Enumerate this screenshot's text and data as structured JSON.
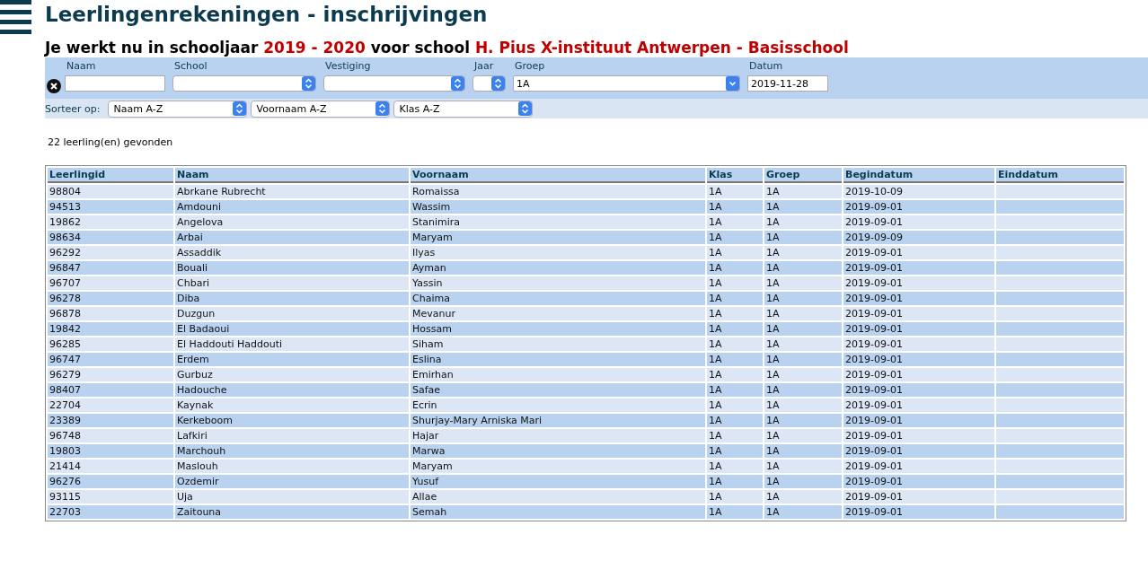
{
  "title": "Leerlingenrekeningen - inschrijvingen",
  "subtitle": [
    {
      "text": "Je werkt nu in schooljaar ",
      "kind": "plain"
    },
    {
      "text": "2019 - 2020",
      "kind": "highlight"
    },
    {
      "text": " voor school ",
      "kind": "plain"
    },
    {
      "text": "H. Pius X-instituut Antwerpen - Basisschool",
      "kind": "highlight"
    }
  ],
  "filters": [
    {
      "label": "Naam",
      "kind": "text"
    },
    {
      "label": "School",
      "kind": "select"
    },
    {
      "label": "Vestiging",
      "kind": "select"
    },
    {
      "label": "Jaar",
      "kind": "select"
    },
    {
      "label": "Groep",
      "kind": "dropdown",
      "value": "1A"
    },
    {
      "label": "Datum",
      "kind": "date",
      "value": "2019-11-28"
    }
  ],
  "sort": {
    "label": "Sorteer op:",
    "options": [
      "Naam A-Z",
      "Voornaam A-Z",
      "Klas A-Z"
    ]
  },
  "result_count": "22 leerling(en) gevonden",
  "table": {
    "columns": [
      "Leerlingid",
      "Naam",
      "Voornaam",
      "Klas",
      "Groep",
      "Begindatum",
      "Einddatum"
    ],
    "rows": [
      [
        "98804",
        "Abrkane Rubrecht",
        "Romaissa",
        "1A",
        "1A",
        "2019-10-09",
        ""
      ],
      [
        "94513",
        "Amdouni",
        "Wassim",
        "1A",
        "1A",
        "2019-09-01",
        ""
      ],
      [
        "19862",
        "Angelova",
        "Stanimira",
        "1A",
        "1A",
        "2019-09-01",
        ""
      ],
      [
        "98634",
        "Arbai",
        "Maryam",
        "1A",
        "1A",
        "2019-09-09",
        ""
      ],
      [
        "96292",
        "Assaddik",
        "Ilyas",
        "1A",
        "1A",
        "2019-09-01",
        ""
      ],
      [
        "96847",
        "Bouali",
        "Ayman",
        "1A",
        "1A",
        "2019-09-01",
        ""
      ],
      [
        "96707",
        "Chbari",
        "Yassin",
        "1A",
        "1A",
        "2019-09-01",
        ""
      ],
      [
        "96278",
        "Diba",
        "Chaima",
        "1A",
        "1A",
        "2019-09-01",
        ""
      ],
      [
        "96878",
        "Duzgun",
        "Mevanur",
        "1A",
        "1A",
        "2019-09-01",
        ""
      ],
      [
        "19842",
        "El Badaoui",
        "Hossam",
        "1A",
        "1A",
        "2019-09-01",
        ""
      ],
      [
        "96285",
        "El Haddouti Haddouti",
        "Siham",
        "1A",
        "1A",
        "2019-09-01",
        ""
      ],
      [
        "96747",
        "Erdem",
        "Eslina",
        "1A",
        "1A",
        "2019-09-01",
        ""
      ],
      [
        "96279",
        "Gurbuz",
        "Emirhan",
        "1A",
        "1A",
        "2019-09-01",
        ""
      ],
      [
        "98407",
        "Hadouche",
        "Safae",
        "1A",
        "1A",
        "2019-09-01",
        ""
      ],
      [
        "22704",
        "Kaynak",
        "Ecrin",
        "1A",
        "1A",
        "2019-09-01",
        ""
      ],
      [
        "23389",
        "Kerkeboom",
        "Shurjay-Mary Arniska Mari",
        "1A",
        "1A",
        "2019-09-01",
        ""
      ],
      [
        "96748",
        "Lafkiri",
        "Hajar",
        "1A",
        "1A",
        "2019-09-01",
        ""
      ],
      [
        "19803",
        "Marchouh",
        "Marwa",
        "1A",
        "1A",
        "2019-09-01",
        ""
      ],
      [
        "21414",
        "Maslouh",
        "Maryam",
        "1A",
        "1A",
        "2019-09-01",
        ""
      ],
      [
        "96276",
        "Ozdemir",
        "Yusuf",
        "1A",
        "1A",
        "2019-09-01",
        ""
      ],
      [
        "93115",
        "Uja",
        "Allae",
        "1A",
        "1A",
        "2019-09-01",
        ""
      ],
      [
        "22703",
        "Zaitouna",
        "Semah",
        "1A",
        "1A",
        "2019-09-01",
        ""
      ]
    ]
  }
}
